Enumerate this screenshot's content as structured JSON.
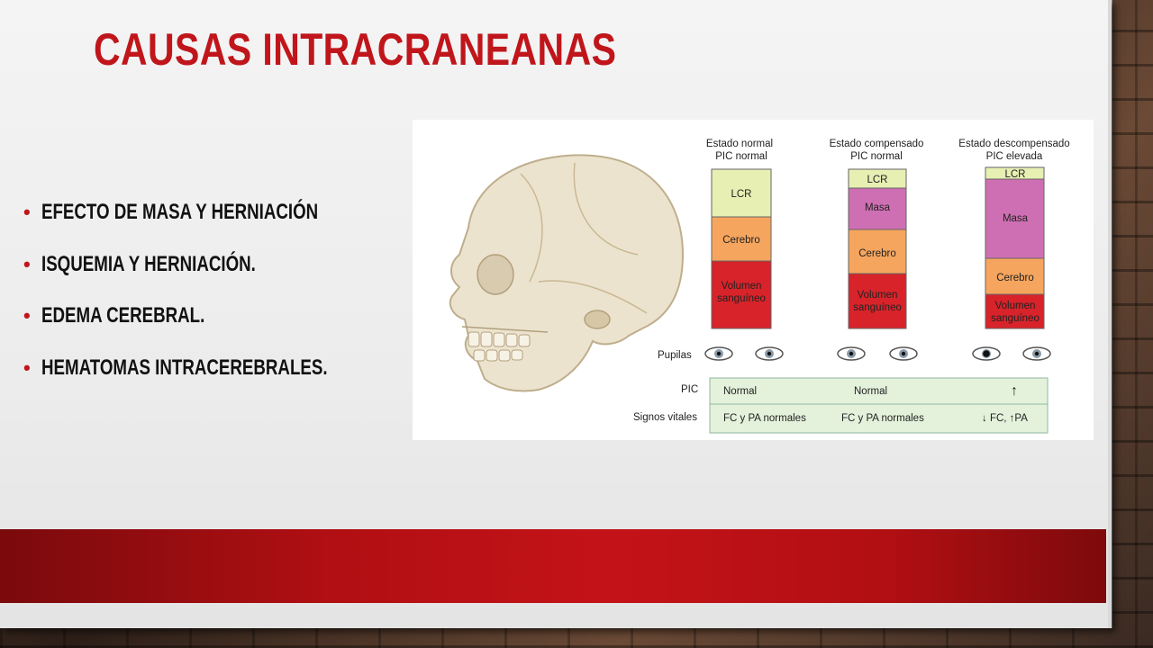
{
  "slide": {
    "title": "CAUSAS INTRACRANEANAS",
    "bullets": [
      {
        "text": "EFECTO DE MASA Y HERNIACIÓN"
      },
      {
        "text": "ISQUEMIA Y HERNIACIÓN."
      },
      {
        "text": "EDEMA CEREBRAL."
      },
      {
        "text": "HEMATOMAS INTRACEREBRALES."
      }
    ]
  },
  "figure": {
    "columns": [
      {
        "heading1": "Estado normal",
        "heading2": "PIC normal",
        "segments": {
          "lcr": "LCR",
          "cerebro": "Cerebro",
          "vol1": "Volumen",
          "vol2": "sanguíneo"
        }
      },
      {
        "heading1": "Estado compensado",
        "heading2": "PIC normal",
        "segments": {
          "lcr": "LCR",
          "masa": "Masa",
          "cerebro": "Cerebro",
          "vol1": "Volumen",
          "vol2": "sanguíneo"
        }
      },
      {
        "heading1": "Estado descompensado",
        "heading2": "PIC elevada",
        "segments": {
          "lcr": "LCR",
          "masa": "Masa",
          "cerebro": "Cerebro",
          "vol1": "Volumen",
          "vol2": "sanguíneo"
        }
      }
    ],
    "row_labels": {
      "pupilas": "Pupilas",
      "pic": "PIC",
      "signos": "Signos vitales"
    },
    "pic_values": [
      "Normal",
      "Normal",
      "↑"
    ],
    "signos_values": [
      "FC y PA normales",
      "FC y PA normales",
      "↓ FC, ↑PA"
    ],
    "colors": {
      "lcr": "#e7efb3",
      "masa": "#cf6fb3",
      "cerebro": "#f6a55e",
      "volumen": "#d8232a",
      "table": "#e4f2dc",
      "accent": "#c0161b"
    }
  }
}
